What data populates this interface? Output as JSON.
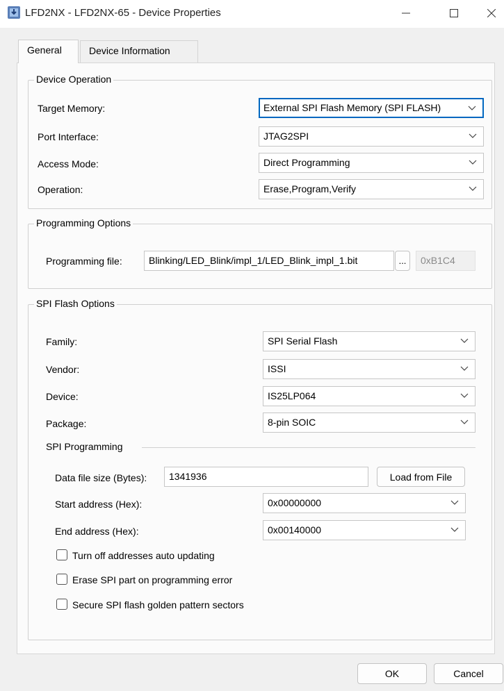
{
  "window": {
    "title": "LFD2NX - LFD2NX-65 - Device Properties",
    "accent": "#0067c0",
    "icon": "chip-download-icon"
  },
  "tabs": [
    {
      "label": "General",
      "active": true
    },
    {
      "label": "Device Information",
      "active": false
    }
  ],
  "device_operation": {
    "title": "Device Operation",
    "target_memory": {
      "label": "Target Memory:",
      "value": "External SPI Flash Memory (SPI FLASH)"
    },
    "port_interface": {
      "label": "Port Interface:",
      "value": "JTAG2SPI"
    },
    "access_mode": {
      "label": "Access Mode:",
      "value": "Direct Programming"
    },
    "operation": {
      "label": "Operation:",
      "value": "Erase,Program,Verify"
    }
  },
  "programming_options": {
    "title": "Programming Options",
    "file_label": "Programming file:",
    "file_value": "Blinking/LED_Blink/impl_1/LED_Blink_impl_1.bit",
    "browse_label": "...",
    "checksum": "0xB1C4"
  },
  "spi_flash_options": {
    "title": "SPI Flash Options",
    "family": {
      "label": "Family:",
      "value": "SPI Serial Flash"
    },
    "vendor": {
      "label": "Vendor:",
      "value": "ISSI"
    },
    "device": {
      "label": "Device:",
      "value": "IS25LP064"
    },
    "package": {
      "label": "Package:",
      "value": "8-pin SOIC"
    },
    "spi_programming": {
      "title": "SPI Programming",
      "data_size_label": "Data file size (Bytes):",
      "data_size_value": "1341936",
      "load_button": "Load from File",
      "start_label": "Start address (Hex):",
      "start_value": "0x00000000",
      "end_label": "End address (Hex):",
      "end_value": "0x00140000"
    },
    "checkboxes": [
      {
        "label": "Turn off addresses auto updating",
        "checked": false
      },
      {
        "label": "Erase SPI part on programming error",
        "checked": false
      },
      {
        "label": "Secure SPI flash golden pattern sectors",
        "checked": false
      }
    ]
  },
  "footer": {
    "ok_label": "OK",
    "cancel_label": "Cancel"
  }
}
